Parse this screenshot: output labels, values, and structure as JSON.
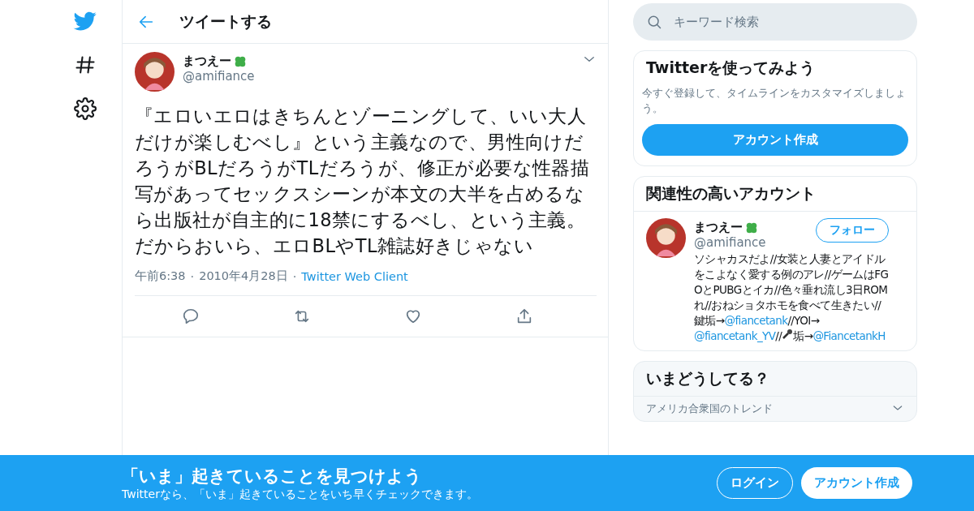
{
  "header": {
    "title": "ツイートする"
  },
  "tweet": {
    "name": "まつえー",
    "handle": "@amifiance",
    "text": "『エロいエロはきちんとゾーニングして、いい大人だけが楽しむべし』という主義なので、男性向けだろうがBLだろうがTLだろうが、修正が必要な性器描写があってセックスシーンが本文の大半を占めるなら出版社が自主的に18禁にするべし、という主義。だからおいら、エロBLやTL雑誌好きじゃない",
    "time": "午前6:38",
    "separator": "·",
    "date": "2010年4月28日",
    "client": "Twitter Web Client"
  },
  "search": {
    "placeholder": "キーワード検索"
  },
  "signup_card": {
    "title": "Twitterを使ってみよう",
    "text": "今すぐ登録して、タイムラインをカスタマイズしましょう。",
    "button": "アカウント作成"
  },
  "related": {
    "title": "関連性の高いアカウント",
    "name": "まつえー",
    "handle": "@amifiance",
    "follow": "フォロー",
    "bio": [
      {
        "kind": "text",
        "text": "ソシャカスだよ//女装と人妻とアイドルをこよなく愛する例のアレ//ゲームはFGOとPUBGとイカ//色々垂れ流し3日ROMれ//おねショタホモを食べて生きたい//鍵垢→"
      },
      {
        "kind": "mention",
        "text": "@fiancetank"
      },
      {
        "kind": "text",
        "text": "//YOI→"
      },
      {
        "kind": "mention",
        "text": "@fiancetank_YV"
      },
      {
        "kind": "text",
        "text": "//"
      },
      {
        "kind": "mic"
      },
      {
        "kind": "text",
        "text": "垢→"
      },
      {
        "kind": "mention",
        "text": "@FiancetankH"
      }
    ]
  },
  "trends": {
    "title": "いまどうしてる？",
    "location": "アメリカ合衆国のトレンド"
  },
  "banner": {
    "title": "「いま」起きていることを見つけよう",
    "subtitle": "Twitterなら、「いま」起きていることをいち早くチェックできます。",
    "login": "ログイン",
    "signup": "アカウント作成"
  }
}
